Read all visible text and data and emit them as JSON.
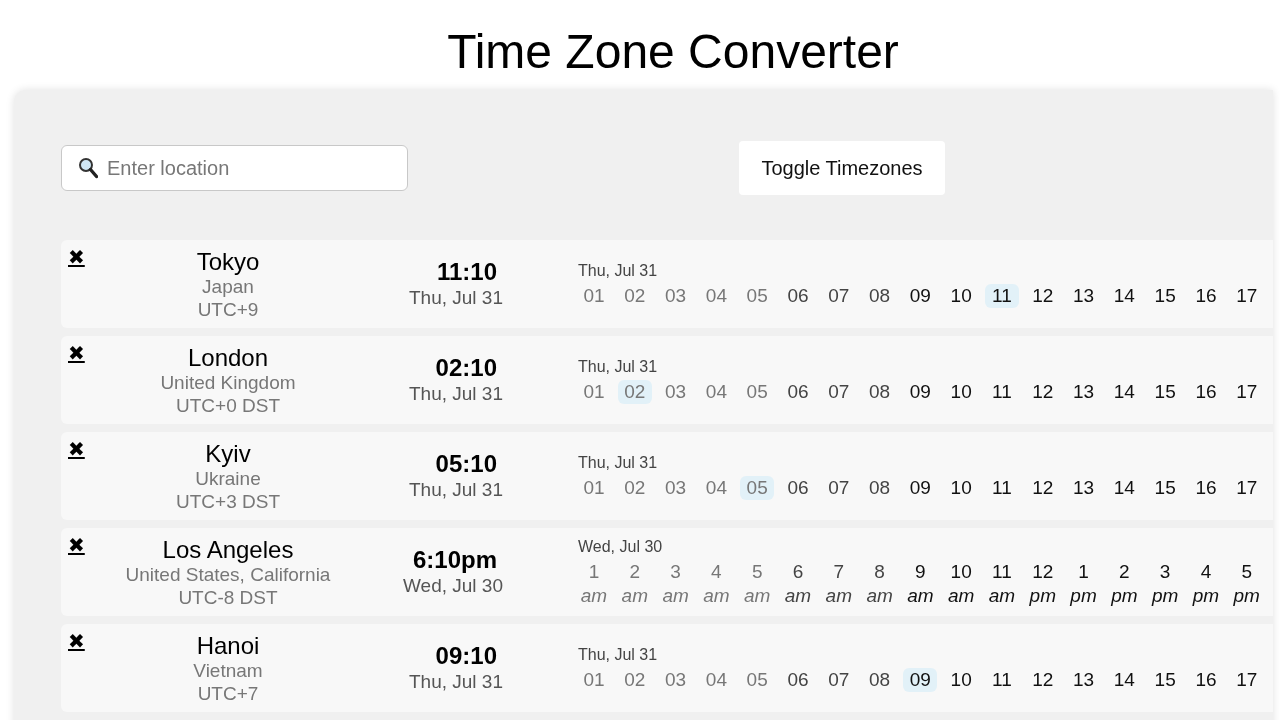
{
  "title": "Time Zone Converter",
  "search": {
    "placeholder": "Enter location"
  },
  "toggle_button": "Toggle Timezones",
  "locations": [
    {
      "remove": "✖",
      "city": "Tokyo",
      "country": "Japan",
      "offset": "UTC+9",
      "time": "11:10",
      "date": "Thu, Jul 31",
      "strip_date": "Thu, Jul 31",
      "hours": [
        {
          "label": "01",
          "color": "#777777",
          "selected": false
        },
        {
          "label": "02",
          "color": "#777777",
          "selected": false
        },
        {
          "label": "03",
          "color": "#777777",
          "selected": false
        },
        {
          "label": "04",
          "color": "#777777",
          "selected": false
        },
        {
          "label": "05",
          "color": "#777777",
          "selected": false
        },
        {
          "label": "06",
          "color": "#444444",
          "selected": false
        },
        {
          "label": "07",
          "color": "#444444",
          "selected": false
        },
        {
          "label": "08",
          "color": "#444444",
          "selected": false
        },
        {
          "label": "09",
          "color": "#111111",
          "selected": false
        },
        {
          "label": "10",
          "color": "#111111",
          "selected": false
        },
        {
          "label": "11",
          "color": "#111111",
          "selected": true
        },
        {
          "label": "12",
          "color": "#111111",
          "selected": false
        },
        {
          "label": "13",
          "color": "#111111",
          "selected": false
        },
        {
          "label": "14",
          "color": "#111111",
          "selected": false
        },
        {
          "label": "15",
          "color": "#111111",
          "selected": false
        },
        {
          "label": "16",
          "color": "#111111",
          "selected": false
        },
        {
          "label": "17",
          "color": "#111111",
          "selected": false
        }
      ]
    },
    {
      "remove": "✖",
      "city": "London",
      "country": "United Kingdom",
      "offset": "UTC+0 DST",
      "time": "02:10",
      "date": "Thu, Jul 31",
      "strip_date": "Thu, Jul 31",
      "hours": [
        {
          "label": "01",
          "color": "#777777",
          "selected": false
        },
        {
          "label": "02",
          "color": "#777777",
          "selected": true
        },
        {
          "label": "03",
          "color": "#777777",
          "selected": false
        },
        {
          "label": "04",
          "color": "#777777",
          "selected": false
        },
        {
          "label": "05",
          "color": "#777777",
          "selected": false
        },
        {
          "label": "06",
          "color": "#444444",
          "selected": false
        },
        {
          "label": "07",
          "color": "#444444",
          "selected": false
        },
        {
          "label": "08",
          "color": "#444444",
          "selected": false
        },
        {
          "label": "09",
          "color": "#111111",
          "selected": false
        },
        {
          "label": "10",
          "color": "#111111",
          "selected": false
        },
        {
          "label": "11",
          "color": "#111111",
          "selected": false
        },
        {
          "label": "12",
          "color": "#111111",
          "selected": false
        },
        {
          "label": "13",
          "color": "#111111",
          "selected": false
        },
        {
          "label": "14",
          "color": "#111111",
          "selected": false
        },
        {
          "label": "15",
          "color": "#111111",
          "selected": false
        },
        {
          "label": "16",
          "color": "#111111",
          "selected": false
        },
        {
          "label": "17",
          "color": "#111111",
          "selected": false
        }
      ]
    },
    {
      "remove": "✖",
      "city": "Kyiv",
      "country": "Ukraine",
      "offset": "UTC+3 DST",
      "time": "05:10",
      "date": "Thu, Jul 31",
      "strip_date": "Thu, Jul 31",
      "hours": [
        {
          "label": "01",
          "color": "#777777",
          "selected": false
        },
        {
          "label": "02",
          "color": "#777777",
          "selected": false
        },
        {
          "label": "03",
          "color": "#777777",
          "selected": false
        },
        {
          "label": "04",
          "color": "#777777",
          "selected": false
        },
        {
          "label": "05",
          "color": "#777777",
          "selected": true
        },
        {
          "label": "06",
          "color": "#444444",
          "selected": false
        },
        {
          "label": "07",
          "color": "#444444",
          "selected": false
        },
        {
          "label": "08",
          "color": "#444444",
          "selected": false
        },
        {
          "label": "09",
          "color": "#111111",
          "selected": false
        },
        {
          "label": "10",
          "color": "#111111",
          "selected": false
        },
        {
          "label": "11",
          "color": "#111111",
          "selected": false
        },
        {
          "label": "12",
          "color": "#111111",
          "selected": false
        },
        {
          "label": "13",
          "color": "#111111",
          "selected": false
        },
        {
          "label": "14",
          "color": "#111111",
          "selected": false
        },
        {
          "label": "15",
          "color": "#111111",
          "selected": false
        },
        {
          "label": "16",
          "color": "#111111",
          "selected": false
        },
        {
          "label": "17",
          "color": "#111111",
          "selected": false
        }
      ]
    },
    {
      "remove": "✖",
      "city": "Los Angeles",
      "country": "United States, California",
      "offset": "UTC-8 DST",
      "time": "6:10pm",
      "date": "Wed, Jul 30",
      "strip_date": "Wed, Jul 30",
      "hours": [
        {
          "label": "1",
          "meridiem": "am",
          "color": "#777777",
          "selected": false
        },
        {
          "label": "2",
          "meridiem": "am",
          "color": "#777777",
          "selected": false
        },
        {
          "label": "3",
          "meridiem": "am",
          "color": "#777777",
          "selected": false
        },
        {
          "label": "4",
          "meridiem": "am",
          "color": "#777777",
          "selected": false
        },
        {
          "label": "5",
          "meridiem": "am",
          "color": "#777777",
          "selected": false
        },
        {
          "label": "6",
          "meridiem": "am",
          "color": "#444444",
          "selected": false
        },
        {
          "label": "7",
          "meridiem": "am",
          "color": "#444444",
          "selected": false
        },
        {
          "label": "8",
          "meridiem": "am",
          "color": "#444444",
          "selected": false
        },
        {
          "label": "9",
          "meridiem": "am",
          "color": "#111111",
          "selected": false
        },
        {
          "label": "10",
          "meridiem": "am",
          "color": "#111111",
          "selected": false
        },
        {
          "label": "11",
          "meridiem": "am",
          "color": "#111111",
          "selected": false
        },
        {
          "label": "12",
          "meridiem": "pm",
          "color": "#111111",
          "selected": false
        },
        {
          "label": "1",
          "meridiem": "pm",
          "color": "#111111",
          "selected": false
        },
        {
          "label": "2",
          "meridiem": "pm",
          "color": "#111111",
          "selected": false
        },
        {
          "label": "3",
          "meridiem": "pm",
          "color": "#111111",
          "selected": false
        },
        {
          "label": "4",
          "meridiem": "pm",
          "color": "#111111",
          "selected": false
        },
        {
          "label": "5",
          "meridiem": "pm",
          "color": "#111111",
          "selected": false
        }
      ]
    },
    {
      "remove": "✖",
      "city": "Hanoi",
      "country": "Vietnam",
      "offset": "UTC+7",
      "time": "09:10",
      "date": "Thu, Jul 31",
      "strip_date": "Thu, Jul 31",
      "hours": [
        {
          "label": "01",
          "color": "#777777",
          "selected": false
        },
        {
          "label": "02",
          "color": "#777777",
          "selected": false
        },
        {
          "label": "03",
          "color": "#777777",
          "selected": false
        },
        {
          "label": "04",
          "color": "#777777",
          "selected": false
        },
        {
          "label": "05",
          "color": "#777777",
          "selected": false
        },
        {
          "label": "06",
          "color": "#444444",
          "selected": false
        },
        {
          "label": "07",
          "color": "#444444",
          "selected": false
        },
        {
          "label": "08",
          "color": "#444444",
          "selected": false
        },
        {
          "label": "09",
          "color": "#111111",
          "selected": true
        },
        {
          "label": "10",
          "color": "#111111",
          "selected": false
        },
        {
          "label": "11",
          "color": "#111111",
          "selected": false
        },
        {
          "label": "12",
          "color": "#111111",
          "selected": false
        },
        {
          "label": "13",
          "color": "#111111",
          "selected": false
        },
        {
          "label": "14",
          "color": "#111111",
          "selected": false
        },
        {
          "label": "15",
          "color": "#111111",
          "selected": false
        },
        {
          "label": "16",
          "color": "#111111",
          "selected": false
        },
        {
          "label": "17",
          "color": "#111111",
          "selected": false
        }
      ]
    }
  ]
}
